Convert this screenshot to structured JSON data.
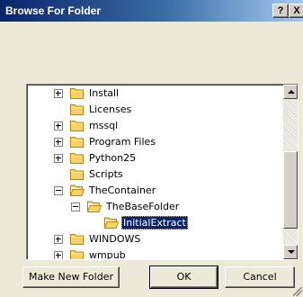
{
  "window": {
    "title": "Browse For Folder",
    "help_glyph": "?",
    "close_glyph": "X"
  },
  "tree": {
    "items": [
      {
        "label": "Install",
        "expander": "plus",
        "level": 0,
        "open": false,
        "selected": false
      },
      {
        "label": "Licenses",
        "expander": "none",
        "level": 0,
        "open": false,
        "selected": false
      },
      {
        "label": "mssql",
        "expander": "plus",
        "level": 0,
        "open": false,
        "selected": false
      },
      {
        "label": "Program Files",
        "expander": "plus",
        "level": 0,
        "open": false,
        "selected": false
      },
      {
        "label": "Python25",
        "expander": "plus",
        "level": 0,
        "open": false,
        "selected": false
      },
      {
        "label": "Scripts",
        "expander": "none",
        "level": 0,
        "open": false,
        "selected": false
      },
      {
        "label": "TheContainer",
        "expander": "minus",
        "level": 0,
        "open": true,
        "selected": false
      },
      {
        "label": "TheBaseFolder",
        "expander": "minus",
        "level": 1,
        "open": true,
        "selected": false
      },
      {
        "label": "InitialExtract",
        "expander": "none",
        "level": 2,
        "open": true,
        "selected": true
      },
      {
        "label": "WINDOWS",
        "expander": "plus",
        "level": 0,
        "open": false,
        "selected": false
      },
      {
        "label": "wmpub",
        "expander": "plus",
        "level": 0,
        "open": false,
        "selected": false
      }
    ]
  },
  "buttons": {
    "make_new_folder": "Make New Folder",
    "ok": "OK",
    "cancel": "Cancel"
  },
  "colors": {
    "title_gradient_start": "#0a246a",
    "title_gradient_end": "#a6caf0",
    "selection": "#0a246a",
    "folder_fill": "#f7d26b",
    "folder_edge": "#b8860b",
    "dialog_background": "#ece9d8"
  }
}
